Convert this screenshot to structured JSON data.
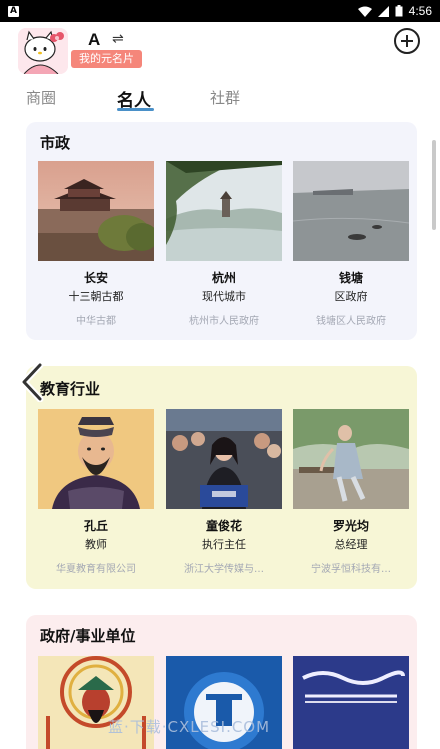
{
  "status": {
    "notif_letter": "A",
    "time": "4:56"
  },
  "header": {
    "username": "A",
    "switch_glyph": "⇌",
    "namecard_label": "我的元名片"
  },
  "tabs": [
    {
      "label": "商圈",
      "active": false
    },
    {
      "label": "名人",
      "active": true
    },
    {
      "label": "社群",
      "active": false
    }
  ],
  "sections": [
    {
      "title": "市政",
      "items": [
        {
          "name": "长安",
          "role": "十三朝古都",
          "org": "中华古都"
        },
        {
          "name": "杭州",
          "role": "现代城市",
          "org": "杭州市人民政府"
        },
        {
          "name": "钱塘",
          "role": "区政府",
          "org": "钱塘区人民政府"
        }
      ]
    },
    {
      "title": "教育行业",
      "items": [
        {
          "name": "孔丘",
          "role": "教师",
          "org": "华夏教育有限公司"
        },
        {
          "name": "童俊花",
          "role": "执行主任",
          "org": "浙江大学传媒与…"
        },
        {
          "name": "罗光均",
          "role": "总经理",
          "org": "宁波孚恒科技有…"
        }
      ]
    },
    {
      "title": "政府/事业单位",
      "items": []
    }
  ],
  "watermark": "蓝·下载·CXLESI.COM",
  "colors": {
    "accent": "#4a90c8",
    "namecard_bg": "#f5867a",
    "card_municipal": "#f3f4fb",
    "card_education": "#f7f6d6",
    "card_government": "#fcedee"
  }
}
